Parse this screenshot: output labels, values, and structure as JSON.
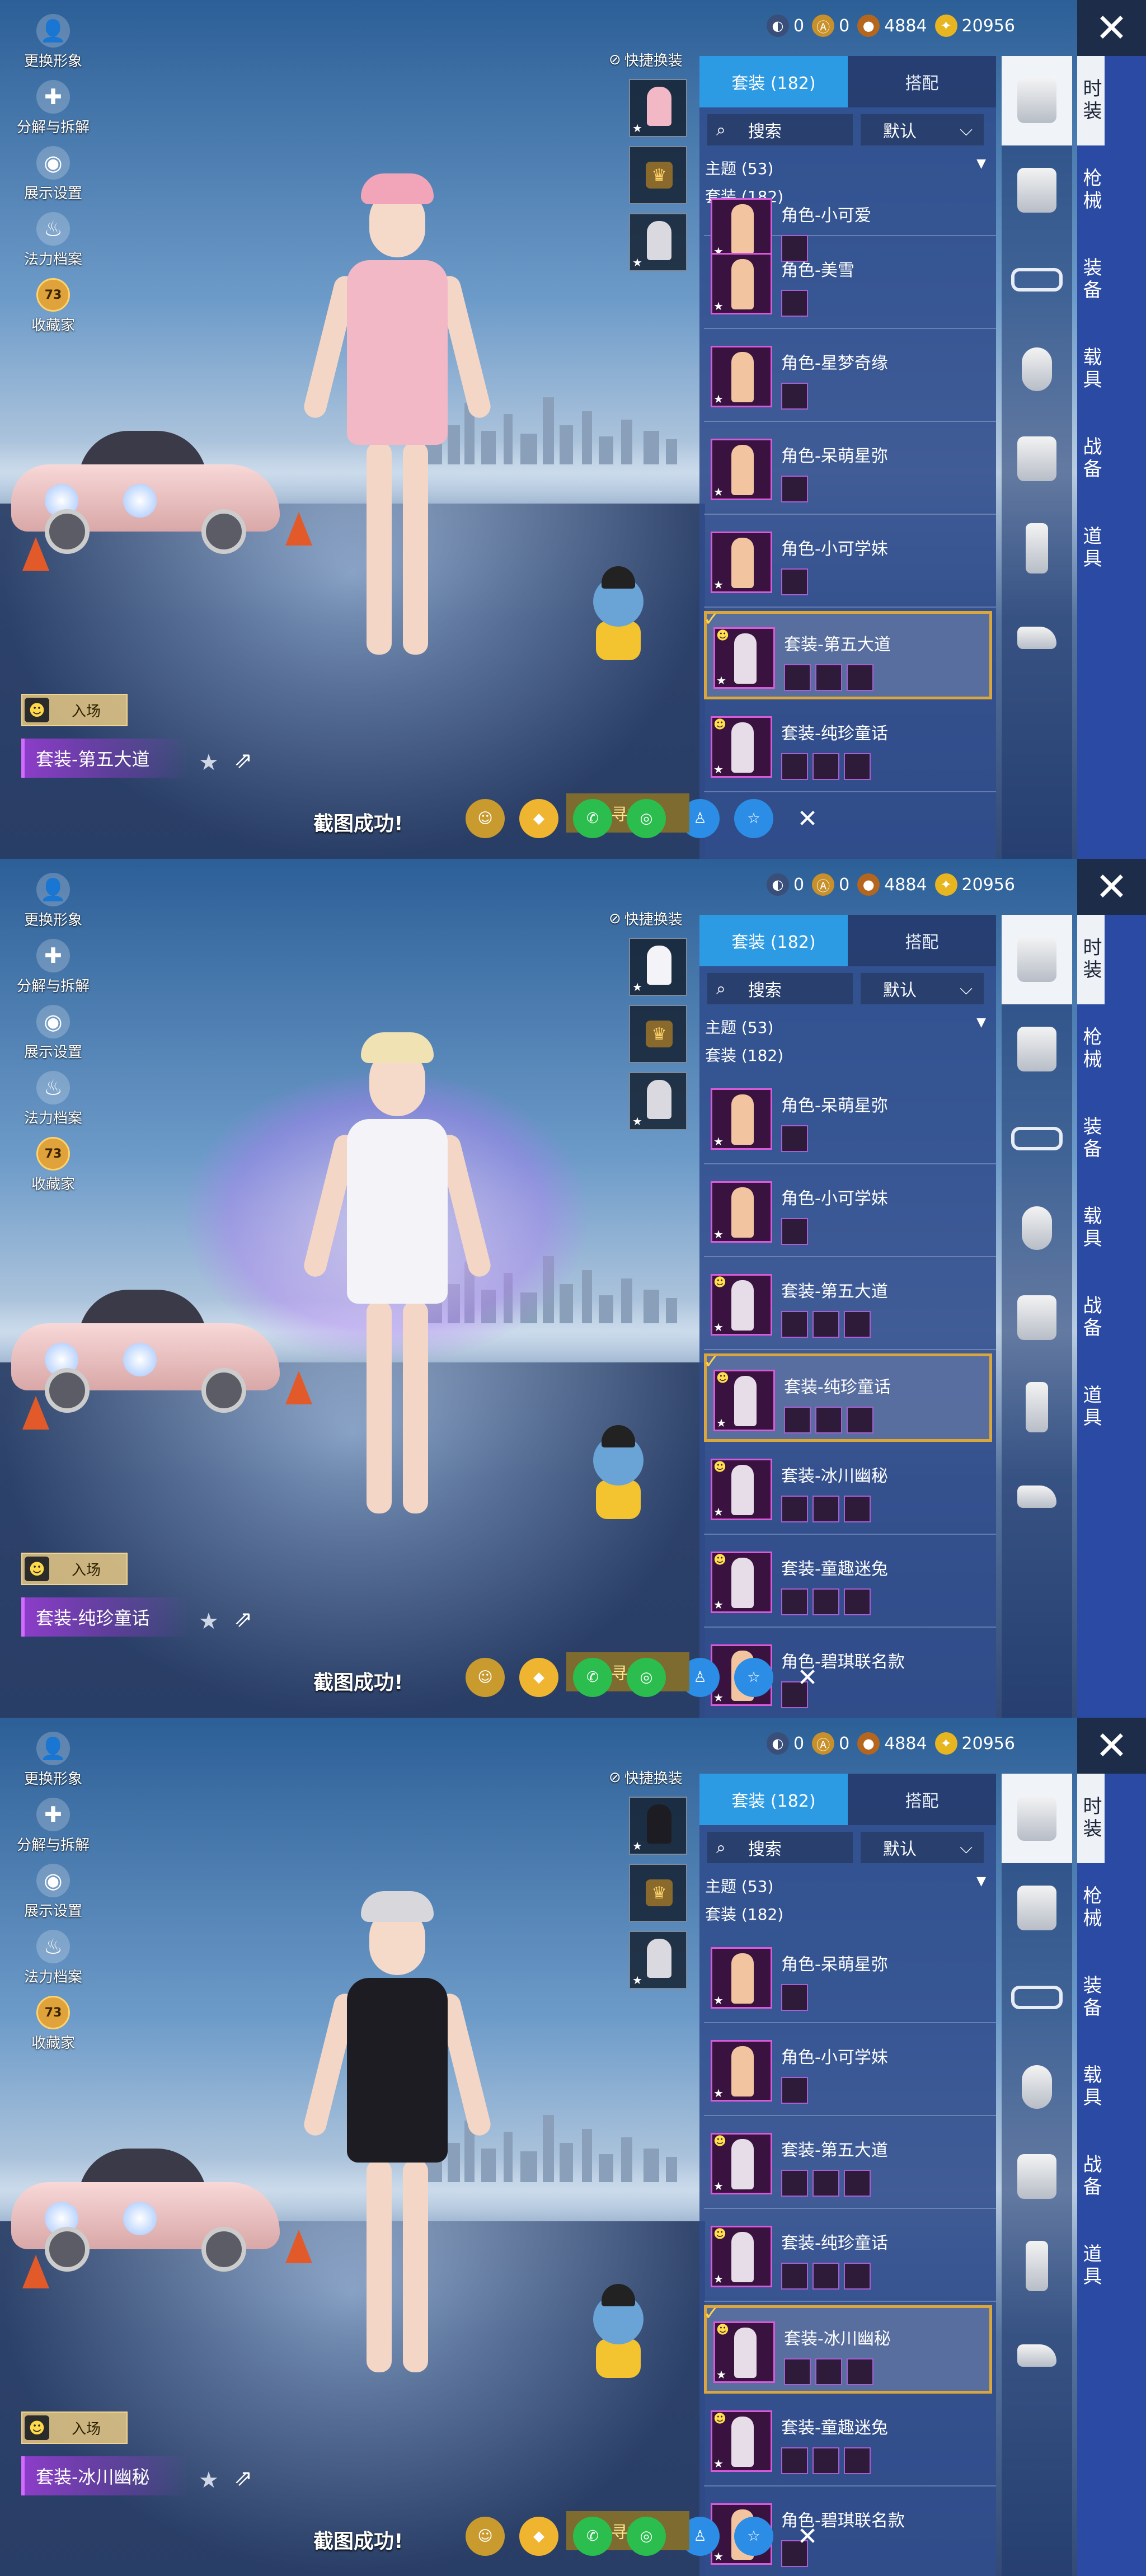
{
  "left_menu": [
    {
      "label": "更换形象",
      "icon": "person-icon"
    },
    {
      "label": "分解与拆解",
      "icon": "puzzle-icon"
    },
    {
      "label": "展示设置",
      "icon": "eye-icon"
    },
    {
      "label": "法力档案",
      "icon": "flame-icon"
    },
    {
      "label": "收藏家",
      "icon": "collector-badge-icon",
      "badge": "73"
    }
  ],
  "currency": [
    {
      "value": "0",
      "icon": "token-icon",
      "color": "#3a4e7a"
    },
    {
      "value": "0",
      "icon": "ag-coin-icon",
      "color": "#c8902a"
    },
    {
      "value": "4884",
      "icon": "bronze-coin-icon",
      "color": "#b4661e"
    },
    {
      "value": "20956",
      "icon": "gold-coin-icon",
      "color": "#e6b520"
    }
  ],
  "close_label": "✕",
  "quick_change_label": "快捷换装",
  "tabs": {
    "outfits": "套装 (182)",
    "match": "搭配"
  },
  "search": {
    "label": "搜索",
    "sort": "默认"
  },
  "theme_label": "主题 (53)",
  "subtheme_label": "套装 (182)",
  "entry_label": "入场",
  "nav": [
    "时装",
    "枪械",
    "装备",
    "载具",
    "战备",
    "道具"
  ],
  "toast": "截图成功!",
  "share_rect_label": "寻找",
  "panels": [
    {
      "current_outfit": "套装-第五大道",
      "outfit_color": "#f2b8c6",
      "list": [
        {
          "name": "角色-小可爱",
          "selected": false,
          "type": "role",
          "partial": true
        },
        {
          "name": "角色-美雪",
          "selected": false,
          "type": "role"
        },
        {
          "name": "角色-星梦奇缘",
          "selected": false,
          "type": "role"
        },
        {
          "name": "角色-呆萌星弥",
          "selected": false,
          "type": "role"
        },
        {
          "name": "角色-小可学妹",
          "selected": false,
          "type": "role"
        },
        {
          "name": "套装-第五大道",
          "selected": true,
          "type": "suit"
        },
        {
          "name": "套装-纯珍童话",
          "selected": false,
          "type": "suit"
        }
      ]
    },
    {
      "current_outfit": "套装-纯珍童话",
      "outfit_color": "#f4f4f8",
      "list": [
        {
          "name": "角色-呆萌星弥",
          "selected": false,
          "type": "role"
        },
        {
          "name": "角色-小可学妹",
          "selected": false,
          "type": "role"
        },
        {
          "name": "套装-第五大道",
          "selected": false,
          "type": "suit"
        },
        {
          "name": "套装-纯珍童话",
          "selected": true,
          "type": "suit"
        },
        {
          "name": "套装-冰川幽秘",
          "selected": false,
          "type": "suit"
        },
        {
          "name": "套装-童趣迷兔",
          "selected": false,
          "type": "suit"
        },
        {
          "name": "角色-碧琪联名款",
          "selected": false,
          "type": "role",
          "partial": true
        }
      ]
    },
    {
      "current_outfit": "套装-冰川幽秘",
      "outfit_color": "#1c1c22",
      "list": [
        {
          "name": "角色-呆萌星弥",
          "selected": false,
          "type": "role"
        },
        {
          "name": "角色-小可学妹",
          "selected": false,
          "type": "role"
        },
        {
          "name": "套装-第五大道",
          "selected": false,
          "type": "suit"
        },
        {
          "name": "套装-纯珍童话",
          "selected": false,
          "type": "suit"
        },
        {
          "name": "套装-冰川幽秘",
          "selected": true,
          "type": "suit"
        },
        {
          "name": "套装-童趣迷兔",
          "selected": false,
          "type": "suit"
        },
        {
          "name": "角色-碧琪联名款",
          "selected": false,
          "type": "role",
          "partial": true
        }
      ]
    }
  ]
}
